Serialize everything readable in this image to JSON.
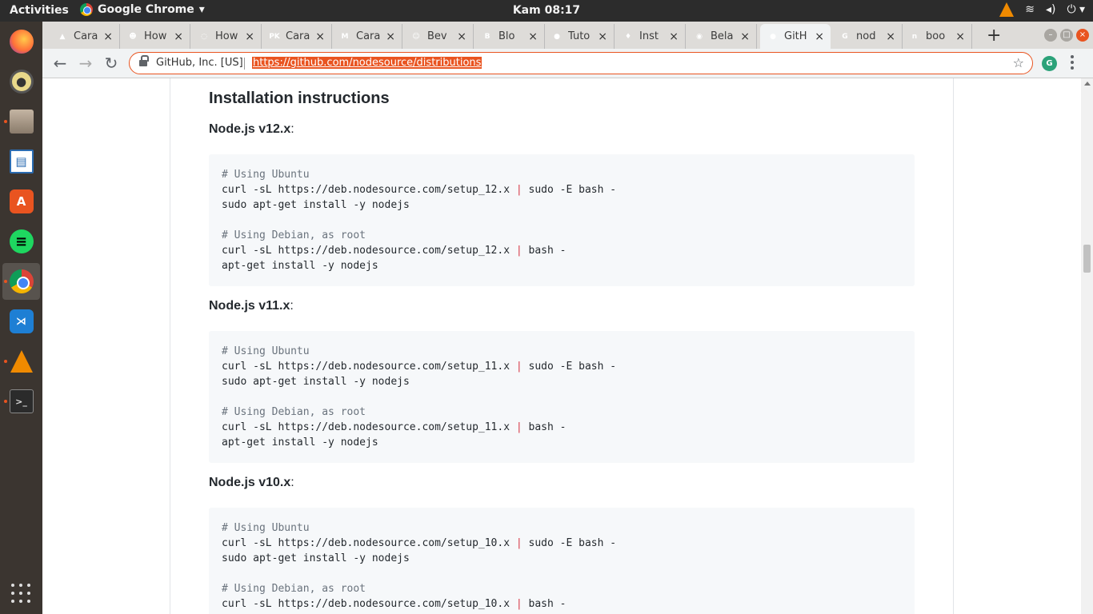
{
  "topbar": {
    "activities": "Activities",
    "app_name": "Google Chrome",
    "clock": "Kam 08:17",
    "wifi_icon": "wifi-icon",
    "volume_icon": "volume-icon",
    "power_icon": "power-icon"
  },
  "dock": {
    "items": [
      {
        "name": "firefox",
        "icon": "firefox-icon"
      },
      {
        "name": "rhythmbox",
        "icon": "rhythmbox-icon"
      },
      {
        "name": "files",
        "icon": "files-icon"
      },
      {
        "name": "libreoffice-writer",
        "icon": "writer-icon"
      },
      {
        "name": "ubuntu-software",
        "icon": "software-store-icon"
      },
      {
        "name": "spotify",
        "icon": "spotify-icon"
      },
      {
        "name": "google-chrome",
        "icon": "chrome-icon"
      },
      {
        "name": "vs-code",
        "icon": "vscode-icon"
      },
      {
        "name": "vlc",
        "icon": "vlc-icon"
      },
      {
        "name": "terminal",
        "icon": "terminal-icon"
      }
    ],
    "terminal_glyph": ">_"
  },
  "tabs": [
    {
      "title": "Cara",
      "color": "#cc2222",
      "glyph": "▲"
    },
    {
      "title": "How",
      "color": "#7a5a3a",
      "glyph": "☻"
    },
    {
      "title": "How",
      "color": "#3b5ec9",
      "glyph": "◌"
    },
    {
      "title": "Cara",
      "color": "#111111",
      "glyph": "PK"
    },
    {
      "title": "Cara",
      "color": "#222222",
      "glyph": "M"
    },
    {
      "title": "Bev",
      "color": "#6b4a2a",
      "glyph": "☺"
    },
    {
      "title": "Blo",
      "color": "#f57d00",
      "glyph": "B"
    },
    {
      "title": "Tuto",
      "color": "#888888",
      "glyph": "●"
    },
    {
      "title": "Inst",
      "color": "#1e3a1e",
      "glyph": "♦"
    },
    {
      "title": "Bela",
      "color": "#1a9e8a",
      "glyph": "◉"
    },
    {
      "title": "GitH",
      "color": "#24292e",
      "glyph": "●"
    },
    {
      "title": "nod",
      "color": "#4285f4",
      "glyph": "G"
    },
    {
      "title": "boo",
      "color": "#d0021b",
      "glyph": "n"
    }
  ],
  "active_tab_index": 10,
  "browser": {
    "new_tab": "+",
    "back": "←",
    "forward": "→",
    "reload": "↻",
    "site_identity": "GitHub, Inc. [US]",
    "url": "https://github.com/nodesource/distributions",
    "star": "☆",
    "extension_glyph": "G"
  },
  "page": {
    "heading": "Installation instructions",
    "sections": [
      {
        "version": "Node.js v12.x",
        "lines": [
          "# Using Ubuntu",
          "curl -sL https://deb.nodesource.com/setup_12.x | sudo -E bash -",
          "sudo apt-get install -y nodejs",
          "",
          "# Using Debian, as root",
          "curl -sL https://deb.nodesource.com/setup_12.x | bash -",
          "apt-get install -y nodejs"
        ]
      },
      {
        "version": "Node.js v11.x",
        "lines": [
          "# Using Ubuntu",
          "curl -sL https://deb.nodesource.com/setup_11.x | sudo -E bash -",
          "sudo apt-get install -y nodejs",
          "",
          "# Using Debian, as root",
          "curl -sL https://deb.nodesource.com/setup_11.x | bash -",
          "apt-get install -y nodejs"
        ]
      },
      {
        "version": "Node.js v10.x",
        "lines": [
          "# Using Ubuntu",
          "curl -sL https://deb.nodesource.com/setup_10.x | sudo -E bash -",
          "sudo apt-get install -y nodejs",
          "",
          "# Using Debian, as root",
          "curl -sL https://deb.nodesource.com/setup_10.x | bash -"
        ]
      }
    ]
  },
  "colors": {
    "accent": "#e95420",
    "code_bg": "#f6f8fa",
    "comment": "#6a737d",
    "pipe": "#d73a49"
  }
}
